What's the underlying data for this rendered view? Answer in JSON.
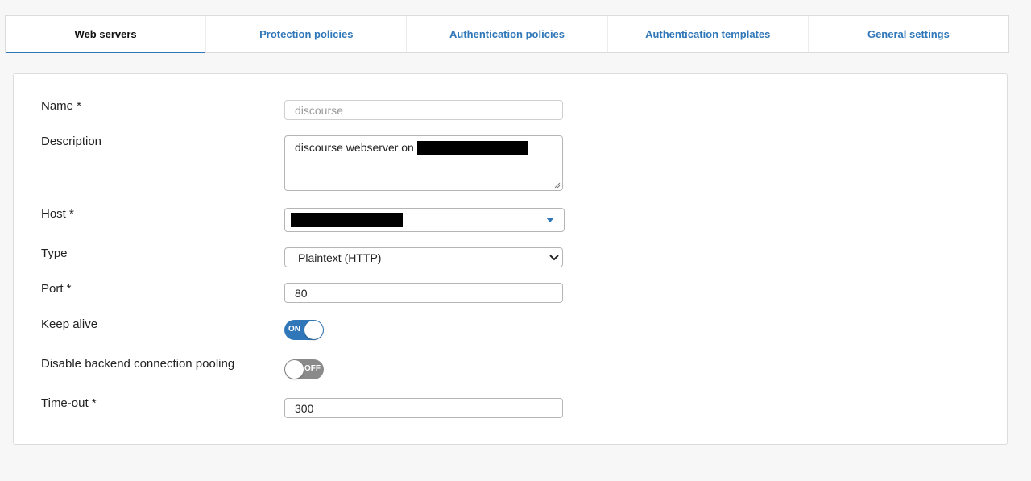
{
  "tabs": [
    {
      "label": "Web servers",
      "active": true
    },
    {
      "label": "Protection policies",
      "active": false
    },
    {
      "label": "Authentication policies",
      "active": false
    },
    {
      "label": "Authentication templates",
      "active": false
    },
    {
      "label": "General settings",
      "active": false
    }
  ],
  "form": {
    "name": {
      "label": "Name *",
      "value": "discourse"
    },
    "description": {
      "label": "Description",
      "value": "discourse webserver on"
    },
    "host": {
      "label": "Host *"
    },
    "type": {
      "label": "Type",
      "value": "Plaintext (HTTP)"
    },
    "port": {
      "label": "Port *",
      "value": "80"
    },
    "keep_alive": {
      "label": "Keep alive",
      "state": "ON"
    },
    "disable_pooling": {
      "label": "Disable backend connection pooling",
      "state": "OFF"
    },
    "timeout": {
      "label": "Time-out *",
      "value": "300"
    }
  },
  "colors": {
    "accent": "#2f77b8",
    "toggle_off": "#8a8a8a"
  }
}
